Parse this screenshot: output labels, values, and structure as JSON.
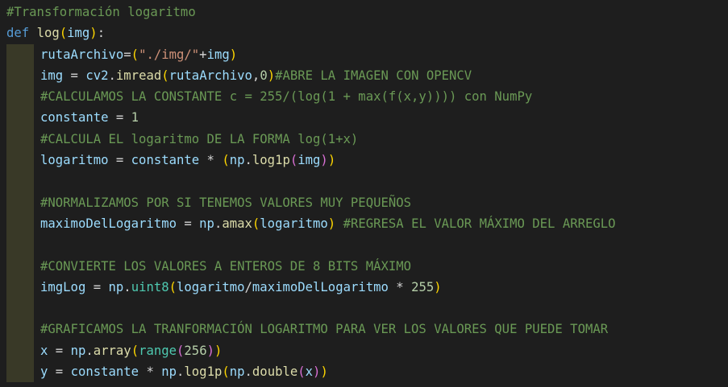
{
  "lines": [
    {
      "kind": "top",
      "tokens": [
        {
          "c": "cmt",
          "t": "#Transformación logaritmo"
        }
      ]
    },
    {
      "kind": "top",
      "tokens": [
        {
          "c": "kw",
          "t": "def"
        },
        {
          "c": "op",
          "t": " "
        },
        {
          "c": "fn",
          "t": "log"
        },
        {
          "c": "b1",
          "t": "("
        },
        {
          "c": "var",
          "t": "img"
        },
        {
          "c": "b1",
          "t": ")"
        },
        {
          "c": "op",
          "t": ":"
        }
      ]
    },
    {
      "kind": "body",
      "tokens": [
        {
          "c": "var",
          "t": "rutaArchivo"
        },
        {
          "c": "op",
          "t": "="
        },
        {
          "c": "b1",
          "t": "("
        },
        {
          "c": "str",
          "t": "\"./img/\""
        },
        {
          "c": "op",
          "t": "+"
        },
        {
          "c": "var",
          "t": "img"
        },
        {
          "c": "b1",
          "t": ")"
        }
      ]
    },
    {
      "kind": "body",
      "tokens": [
        {
          "c": "var",
          "t": "img"
        },
        {
          "c": "op",
          "t": " = "
        },
        {
          "c": "var",
          "t": "cv2"
        },
        {
          "c": "op",
          "t": "."
        },
        {
          "c": "fn",
          "t": "imread"
        },
        {
          "c": "b1",
          "t": "("
        },
        {
          "c": "var",
          "t": "rutaArchivo"
        },
        {
          "c": "op",
          "t": ","
        },
        {
          "c": "num",
          "t": "0"
        },
        {
          "c": "b1",
          "t": ")"
        },
        {
          "c": "cmt",
          "t": "#ABRE LA IMAGEN CON OPENCV"
        }
      ]
    },
    {
      "kind": "body",
      "tokens": [
        {
          "c": "cmt",
          "t": "#CALCULAMOS LA CONSTANTE c = 255/(log(1 + max(f(x,y)))) con NumPy"
        }
      ]
    },
    {
      "kind": "body",
      "tokens": [
        {
          "c": "var",
          "t": "constante"
        },
        {
          "c": "op",
          "t": " = "
        },
        {
          "c": "num",
          "t": "1"
        }
      ]
    },
    {
      "kind": "body",
      "tokens": [
        {
          "c": "cmt",
          "t": "#CALCULA EL logaritmo DE LA FORMA log(1+x)"
        }
      ]
    },
    {
      "kind": "body",
      "tokens": [
        {
          "c": "var",
          "t": "logaritmo"
        },
        {
          "c": "op",
          "t": " = "
        },
        {
          "c": "var",
          "t": "constante"
        },
        {
          "c": "op",
          "t": " * "
        },
        {
          "c": "b1",
          "t": "("
        },
        {
          "c": "var",
          "t": "np"
        },
        {
          "c": "op",
          "t": "."
        },
        {
          "c": "fn",
          "t": "log1p"
        },
        {
          "c": "b2",
          "t": "("
        },
        {
          "c": "var",
          "t": "img"
        },
        {
          "c": "b2",
          "t": ")"
        },
        {
          "c": "b1",
          "t": ")"
        }
      ]
    },
    {
      "kind": "body",
      "tokens": []
    },
    {
      "kind": "body",
      "tokens": [
        {
          "c": "cmt",
          "t": "#NORMALIZAMOS POR SI TENEMOS VALORES MUY PEQUEÑOS"
        }
      ]
    },
    {
      "kind": "body",
      "tokens": [
        {
          "c": "var",
          "t": "maximoDelLogaritmo"
        },
        {
          "c": "op",
          "t": " = "
        },
        {
          "c": "var",
          "t": "np"
        },
        {
          "c": "op",
          "t": "."
        },
        {
          "c": "fn",
          "t": "amax"
        },
        {
          "c": "b1",
          "t": "("
        },
        {
          "c": "var",
          "t": "logaritmo"
        },
        {
          "c": "b1",
          "t": ")"
        },
        {
          "c": "op",
          "t": " "
        },
        {
          "c": "cmt",
          "t": "#REGRESA EL VALOR MÁXIMO DEL ARREGLO"
        }
      ]
    },
    {
      "kind": "body",
      "tokens": []
    },
    {
      "kind": "body",
      "tokens": [
        {
          "c": "cmt",
          "t": "#CONVIERTE LOS VALORES A ENTEROS DE 8 BITS MÁXIMO"
        }
      ]
    },
    {
      "kind": "body",
      "tokens": [
        {
          "c": "var",
          "t": "imgLog"
        },
        {
          "c": "op",
          "t": " = "
        },
        {
          "c": "var",
          "t": "np"
        },
        {
          "c": "op",
          "t": "."
        },
        {
          "c": "type",
          "t": "uint8"
        },
        {
          "c": "b1",
          "t": "("
        },
        {
          "c": "var",
          "t": "logaritmo"
        },
        {
          "c": "op",
          "t": "/"
        },
        {
          "c": "var",
          "t": "maximoDelLogaritmo"
        },
        {
          "c": "op",
          "t": " * "
        },
        {
          "c": "num",
          "t": "255"
        },
        {
          "c": "b1",
          "t": ")"
        }
      ]
    },
    {
      "kind": "body",
      "tokens": []
    },
    {
      "kind": "body",
      "tokens": [
        {
          "c": "cmt",
          "t": "#GRAFICAMOS LA TRANFORMACIÓN LOGARITMO PARA VER LOS VALORES QUE PUEDE TOMAR"
        }
      ]
    },
    {
      "kind": "body",
      "tokens": [
        {
          "c": "var",
          "t": "x"
        },
        {
          "c": "op",
          "t": " = "
        },
        {
          "c": "var",
          "t": "np"
        },
        {
          "c": "op",
          "t": "."
        },
        {
          "c": "fn",
          "t": "array"
        },
        {
          "c": "b1",
          "t": "("
        },
        {
          "c": "type",
          "t": "range"
        },
        {
          "c": "b2",
          "t": "("
        },
        {
          "c": "num",
          "t": "256"
        },
        {
          "c": "b2",
          "t": ")"
        },
        {
          "c": "b1",
          "t": ")"
        }
      ]
    },
    {
      "kind": "body",
      "tokens": [
        {
          "c": "var",
          "t": "y"
        },
        {
          "c": "op",
          "t": " = "
        },
        {
          "c": "var",
          "t": "constante"
        },
        {
          "c": "op",
          "t": " * "
        },
        {
          "c": "var",
          "t": "np"
        },
        {
          "c": "op",
          "t": "."
        },
        {
          "c": "fn",
          "t": "log1p"
        },
        {
          "c": "b1",
          "t": "("
        },
        {
          "c": "var",
          "t": "np"
        },
        {
          "c": "op",
          "t": "."
        },
        {
          "c": "fn",
          "t": "double"
        },
        {
          "c": "b2",
          "t": "("
        },
        {
          "c": "var",
          "t": "x"
        },
        {
          "c": "b2",
          "t": ")"
        },
        {
          "c": "b1",
          "t": ")"
        }
      ]
    }
  ]
}
